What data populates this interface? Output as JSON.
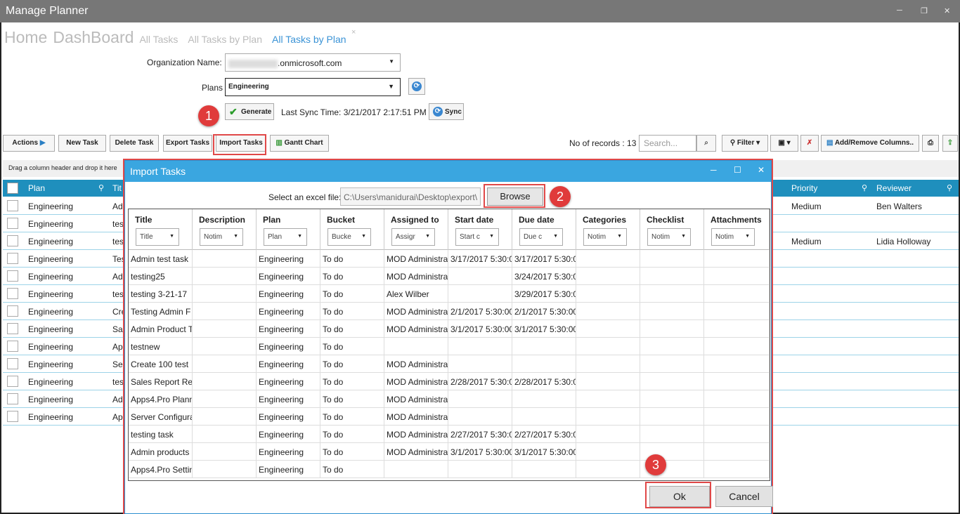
{
  "window": {
    "title": "Manage Planner",
    "minimize": "─",
    "restore": "❐",
    "close": "✕"
  },
  "nav": {
    "home": "Home",
    "dashboard": "DashBoard",
    "all_tasks": "All Tasks",
    "all_tasks_by_plan": "All Tasks by Plan",
    "active_tab": "All Tasks by Plan",
    "close_tab": "×"
  },
  "form": {
    "org_label": "Organization Name:",
    "org_value": ".onmicrosoft.com",
    "plans_label": "Plans",
    "plans_value": "Engineering",
    "generate_label": "Generate",
    "last_sync_text": "Last Sync Time: 3/21/2017 2:17:51 PM",
    "sync_label": "Sync"
  },
  "toolbar": {
    "actions": "Actions",
    "new_task": "New Task",
    "delete_task": "Delete Task",
    "export_tasks": "Export Tasks",
    "import_tasks": "Import Tasks",
    "gantt_chart": "Gantt Chart",
    "records": "No of records : 13",
    "search_placeholder": "Search...",
    "filter": "Filter",
    "add_remove_columns": "Add/Remove Columns.."
  },
  "callouts": {
    "one": "1",
    "two": "2",
    "three": "3"
  },
  "grid": {
    "group_hint": "Drag a column header and drop it here",
    "headers": {
      "plan": "Plan",
      "title": "Tit",
      "priority": "Priority",
      "reviewer": "Reviewer"
    },
    "rows": [
      {
        "plan": "Engineering",
        "title": "Ad",
        "priority": "Medium",
        "reviewer": "Ben Walters"
      },
      {
        "plan": "Engineering",
        "title": "tes",
        "priority": "",
        "reviewer": ""
      },
      {
        "plan": "Engineering",
        "title": "tes",
        "priority": "Medium",
        "reviewer": "Lidia Holloway"
      },
      {
        "plan": "Engineering",
        "title": "Tes",
        "priority": "",
        "reviewer": ""
      },
      {
        "plan": "Engineering",
        "title": "Ad",
        "priority": "",
        "reviewer": ""
      },
      {
        "plan": "Engineering",
        "title": "tes",
        "priority": "",
        "reviewer": ""
      },
      {
        "plan": "Engineering",
        "title": "Cre",
        "priority": "",
        "reviewer": ""
      },
      {
        "plan": "Engineering",
        "title": "Sal",
        "priority": "",
        "reviewer": ""
      },
      {
        "plan": "Engineering",
        "title": "Ap",
        "priority": "",
        "reviewer": ""
      },
      {
        "plan": "Engineering",
        "title": "Se",
        "priority": "",
        "reviewer": ""
      },
      {
        "plan": "Engineering",
        "title": "tes",
        "priority": "",
        "reviewer": ""
      },
      {
        "plan": "Engineering",
        "title": "Ad",
        "priority": "",
        "reviewer": ""
      },
      {
        "plan": "Engineering",
        "title": "Ap",
        "priority": "",
        "reviewer": ""
      }
    ]
  },
  "import_dialog": {
    "title": "Import Tasks",
    "file_label": "Select an excel file:",
    "file_path": "C:\\Users\\manidurai\\Desktop\\export\\",
    "browse": "Browse",
    "ok": "Ok",
    "cancel": "Cancel",
    "columns": [
      {
        "name": "Title",
        "filter": "Title"
      },
      {
        "name": "Description",
        "filter": "Notim"
      },
      {
        "name": "Plan",
        "filter": "Plan"
      },
      {
        "name": "Bucket",
        "filter": "Bucke"
      },
      {
        "name": "Assigned to",
        "filter": "Assigr"
      },
      {
        "name": "Start date",
        "filter": "Start c"
      },
      {
        "name": "Due date",
        "filter": "Due c"
      },
      {
        "name": "Categories",
        "filter": "Notim"
      },
      {
        "name": "Checklist",
        "filter": "Notim"
      },
      {
        "name": "Attachments",
        "filter": "Notim"
      }
    ],
    "rows": [
      [
        "Admin test task",
        "",
        "Engineering",
        "To do",
        "MOD Administra",
        "3/17/2017 5:30:0",
        "3/17/2017 5:30:0",
        "",
        "",
        ""
      ],
      [
        "testing25",
        "",
        "Engineering",
        "To do",
        "MOD Administra",
        "",
        "3/24/2017 5:30:0",
        "",
        "",
        ""
      ],
      [
        "testing 3-21-17",
        "",
        "Engineering",
        "To do",
        "Alex Wilber",
        "",
        "3/29/2017 5:30:0",
        "",
        "",
        ""
      ],
      [
        "Testing Admin F",
        "",
        "Engineering",
        "To do",
        "MOD Administra",
        "2/1/2017 5:30:00",
        "2/1/2017 5:30:00",
        "",
        "",
        ""
      ],
      [
        "Admin Product T",
        "",
        "Engineering",
        "To do",
        "MOD Administra",
        "3/1/2017 5:30:00",
        "3/1/2017 5:30:00",
        "",
        "",
        ""
      ],
      [
        "testnew",
        "",
        "Engineering",
        "To do",
        "",
        "",
        "",
        "",
        "",
        ""
      ],
      [
        "Create 100 test",
        "",
        "Engineering",
        "To do",
        "MOD Administra",
        "",
        "",
        "",
        "",
        ""
      ],
      [
        "Sales Report Re",
        "",
        "Engineering",
        "To do",
        "MOD Administra",
        "2/28/2017 5:30:0",
        "2/28/2017 5:30:0",
        "",
        "",
        ""
      ],
      [
        "Apps4.Pro Plann",
        "",
        "Engineering",
        "To do",
        "MOD Administra",
        "",
        "",
        "",
        "",
        ""
      ],
      [
        "Server Configura",
        "",
        "Engineering",
        "To do",
        "MOD Administra",
        "",
        "",
        "",
        "",
        ""
      ],
      [
        "testing task",
        "",
        "Engineering",
        "To do",
        "MOD Administra",
        "2/27/2017 5:30:0",
        "2/27/2017 5:30:0",
        "",
        "",
        ""
      ],
      [
        "Admin products",
        "",
        "Engineering",
        "To do",
        "MOD Administra",
        "3/1/2017 5:30:00",
        "3/1/2017 5:30:00",
        "",
        "",
        ""
      ],
      [
        "Apps4.Pro Settin",
        "",
        "Engineering",
        "To do",
        "",
        "",
        "",
        "",
        "",
        ""
      ]
    ]
  }
}
